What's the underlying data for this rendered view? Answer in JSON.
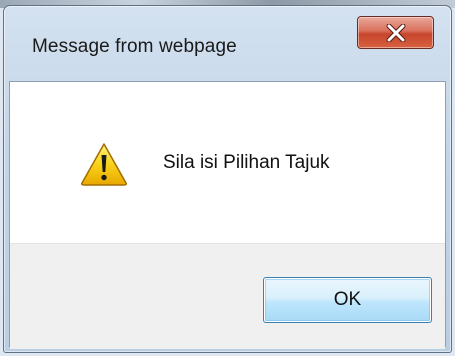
{
  "dialog": {
    "title": "Message from webpage",
    "message": "Sila isi Pilihan Tajuk",
    "ok_label": "OK",
    "close_icon": "close-icon",
    "warning_icon": "warning-icon"
  },
  "colors": {
    "close_button": "#c6452c",
    "ok_button_border": "#3c7fb1",
    "warning_fill": "#f5c400",
    "button_area": "#f0f0f0"
  }
}
